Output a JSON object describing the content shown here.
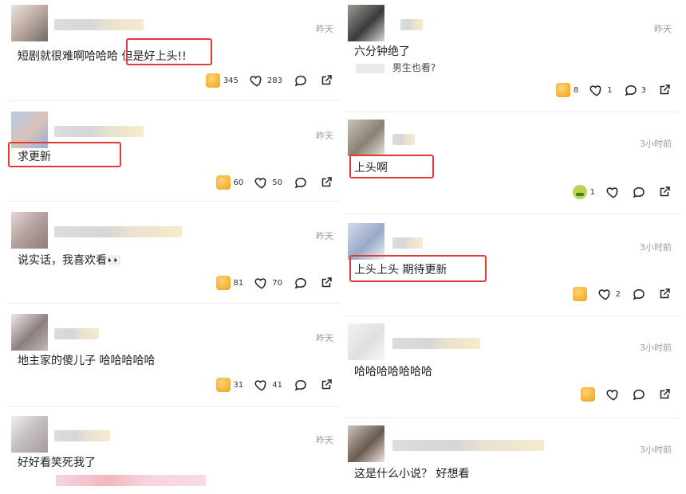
{
  "left": [
    {
      "time": "昨天",
      "text_a": "短剧就很难啊哈哈哈",
      "text_b": "但是好上头!!",
      "likes": "345",
      "loves": "283"
    },
    {
      "time": "昨天",
      "text": "求更新",
      "likes": "60",
      "loves": "50"
    },
    {
      "time": "昨天",
      "text": "说实话，我喜欢看👀",
      "likes": "81",
      "loves": "70"
    },
    {
      "time": "昨天",
      "text": "地主家的傻儿子 哈哈哈哈哈",
      "likes": "31",
      "loves": "41"
    },
    {
      "time": "昨天",
      "text": "好好看笑死我了"
    }
  ],
  "right": [
    {
      "time": "昨天",
      "text": "六分钟绝了",
      "reply": "男生也看?",
      "likes": "8",
      "loves": "1",
      "comments": "3"
    },
    {
      "time": "3小时前",
      "text": "上头啊",
      "reaction": "1"
    },
    {
      "time": "3小时前",
      "text": "上头上头 期待更新",
      "loves": "2"
    },
    {
      "time": "3小时前",
      "text": "哈哈哈哈哈哈哈"
    },
    {
      "time": "3小时前",
      "text": "这是什么小说？ 好想看"
    }
  ]
}
